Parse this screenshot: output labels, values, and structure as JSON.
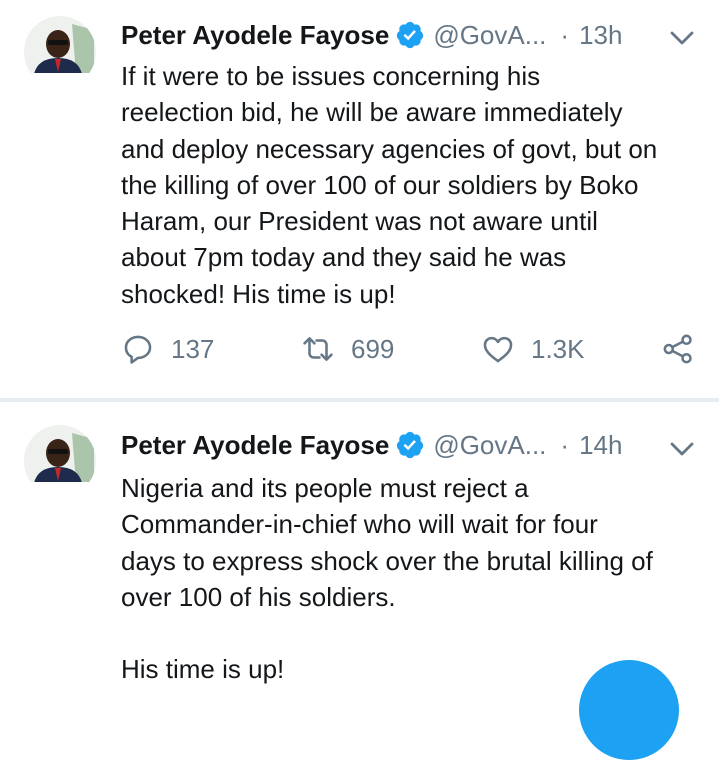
{
  "tweets": [
    {
      "display_name": "Peter Ayodele Fayose",
      "handle": "@GovA...",
      "separator": "·",
      "time": "13h",
      "avatar_caption": "PETER AYODELE FAYOSE",
      "text": "If it were to be issues concerning his\nreelection bid, he will be aware immediately\nand deploy necessary agencies of govt, but on\nthe killing of over 100 of our soldiers by Boko\nHaram, our President was not aware until\nabout 7pm today and they said he was\nshocked! His time is up!",
      "actions": {
        "reply_count": "137",
        "retweet_count": "699",
        "like_count": "1.3K"
      }
    },
    {
      "display_name": "Peter Ayodele Fayose",
      "handle": "@GovA...",
      "separator": "·",
      "time": "14h",
      "avatar_caption": "PETER AYODELE FAYOSE",
      "text": "Nigeria and its people must reject a\nCommander-in-chief who will wait for four\ndays to express shock over the brutal killing of\nover 100 of his soldiers.\n\nHis time is up!"
    }
  ],
  "icons": {
    "verified": "verified-badge-icon",
    "chevron": "chevron-down-icon",
    "reply": "reply-icon",
    "retweet": "retweet-icon",
    "like": "heart-icon",
    "share": "share-icon"
  },
  "colors": {
    "accent": "#1da1f2",
    "muted": "#657786",
    "text": "#14171a",
    "divider": "#e6ecf0"
  }
}
